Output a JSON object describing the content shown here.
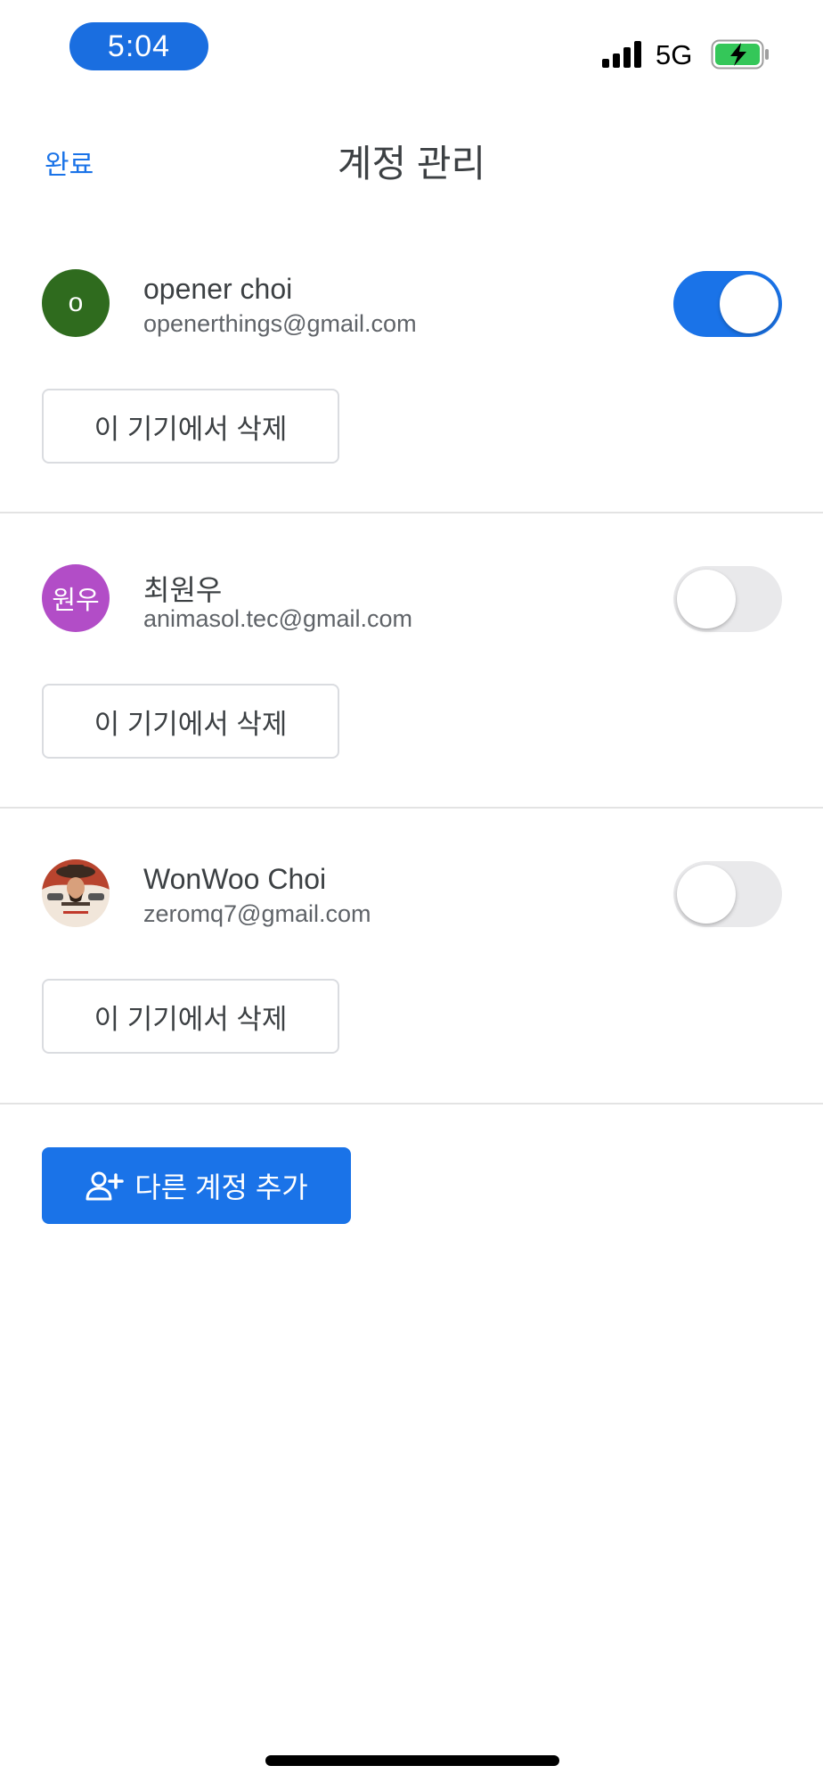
{
  "status_bar": {
    "time": "5:04",
    "network": "5G"
  },
  "header": {
    "done_label": "완료",
    "title": "계정 관리"
  },
  "accounts": [
    {
      "avatar_text": "o",
      "avatar_color": "#2f6b1e",
      "name": "opener choi",
      "email": "openerthings@gmail.com",
      "active": true,
      "remove_label": "이 기기에서 삭제"
    },
    {
      "avatar_text": "원우",
      "avatar_color": "#b24dc7",
      "name": "최원우",
      "email": "animasol.tec@gmail.com",
      "active": false,
      "remove_label": "이 기기에서 삭제"
    },
    {
      "avatar_icon": "profile-photo",
      "name": "WonWoo Choi",
      "email": "zeromq7@gmail.com",
      "active": false,
      "remove_label": "이 기기에서 삭제"
    }
  ],
  "add_account": {
    "label": "다른 계정 추가",
    "icon": "person-add-icon"
  },
  "colors": {
    "accent": "#1a73e8",
    "toggle_off": "#e9e9eb",
    "time_pill": "#1a6ee0",
    "battery_charging": "#34c759"
  }
}
